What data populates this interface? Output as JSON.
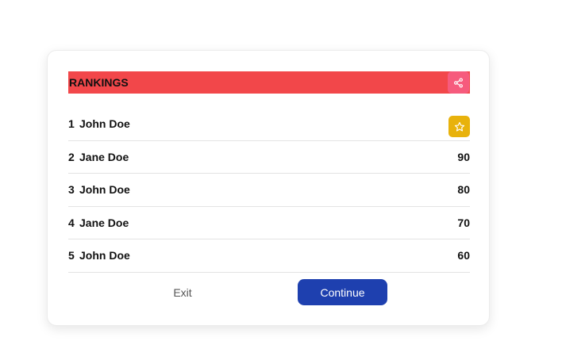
{
  "header": {
    "title": "RANKINGS",
    "share_icon": "share-icon",
    "color": "#f2474a",
    "share_color": "#f65b7d"
  },
  "rankings": [
    {
      "rank": "1",
      "name": "John Doe",
      "score": "",
      "badge_icon": "star-icon",
      "badge_color": "#e8b20c"
    },
    {
      "rank": "2",
      "name": "Jane Doe",
      "score": "90"
    },
    {
      "rank": "3",
      "name": "John Doe",
      "score": "80"
    },
    {
      "rank": "4",
      "name": "Jane Doe",
      "score": "70"
    },
    {
      "rank": "5",
      "name": "John Doe",
      "score": "60"
    }
  ],
  "actions": {
    "exit_label": "Exit",
    "continue_label": "Continue",
    "continue_color": "#1e40af"
  }
}
